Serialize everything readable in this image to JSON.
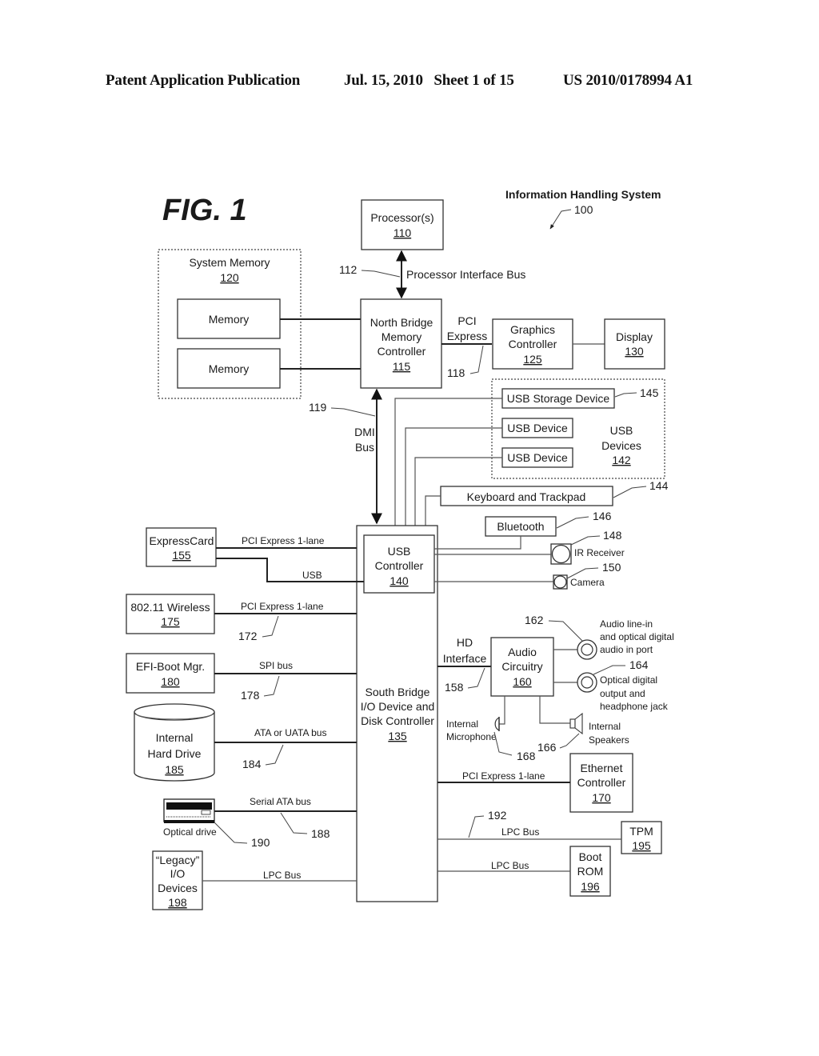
{
  "header": {
    "left": "Patent Application Publication",
    "date_sheet": "Jul. 15, 2010   Sheet 1 of 15",
    "pub_no": "US 2010/0178994 A1"
  },
  "figure": {
    "label": "FIG. 1",
    "system_title": "Information Handling System",
    "system_ref": "100"
  },
  "blocks": {
    "processor": {
      "name": "Processor(s)",
      "ref": "110"
    },
    "system_memory": {
      "name": "System Memory",
      "ref": "120"
    },
    "memory_a": {
      "name": "Memory"
    },
    "memory_b": {
      "name": "Memory"
    },
    "north_bridge": {
      "line1": "North Bridge",
      "line2": "Memory",
      "line3": "Controller",
      "ref": "115"
    },
    "graphics": {
      "line1": "Graphics",
      "line2": "Controller",
      "ref": "125"
    },
    "display": {
      "name": "Display",
      "ref": "130"
    },
    "usb_storage": {
      "name": "USB Storage Device",
      "ref": "145"
    },
    "usb_device_1": {
      "name": "USB Device"
    },
    "usb_device_2": {
      "name": "USB Device"
    },
    "usb_devices_group": {
      "line1": "USB",
      "line2": "Devices",
      "ref": "142"
    },
    "keyboard": {
      "name": "Keyboard and Trackpad",
      "ref": "144"
    },
    "bluetooth": {
      "name": "Bluetooth",
      "ref": "146"
    },
    "ir_receiver": {
      "name": "IR Receiver",
      "ref": "148"
    },
    "camera": {
      "name": "Camera",
      "ref": "150"
    },
    "usb_controller": {
      "line1": "USB",
      "line2": "Controller",
      "ref": "140"
    },
    "expresscard": {
      "name": "ExpressCard",
      "ref": "155"
    },
    "wireless": {
      "name": "802.11 Wireless",
      "ref": "175"
    },
    "efi": {
      "name": "EFI-Boot Mgr.",
      "ref": "180"
    },
    "hard_drive": {
      "line1": "Internal",
      "line2": "Hard Drive",
      "ref": "185"
    },
    "optical": {
      "name": "Optical drive",
      "ref": "190"
    },
    "legacy": {
      "line1": "“Legacy”",
      "line2": "I/O",
      "line3": "Devices",
      "ref": "198"
    },
    "south_bridge": {
      "line1": "South Bridge",
      "line2": "I/O Device and",
      "line3": "Disk Controller",
      "ref": "135"
    },
    "audio": {
      "line1": "Audio",
      "line2": "Circuitry",
      "ref": "160"
    },
    "audio_in": {
      "line1": "Audio line-in",
      "line2": "and optical digital",
      "line3": "audio in port",
      "ref": "162"
    },
    "audio_out": {
      "line1": "Optical digital",
      "line2": "output and",
      "line3": "headphone jack",
      "ref": "164"
    },
    "speakers": {
      "line1": "Internal",
      "line2": "Speakers",
      "ref": "166"
    },
    "microphone": {
      "line1": "Internal",
      "line2": "Microphone",
      "ref": "168"
    },
    "ethernet": {
      "line1": "Ethernet",
      "line2": "Controller",
      "ref": "170"
    },
    "tpm": {
      "name": "TPM",
      "ref": "195"
    },
    "boot_rom": {
      "line1": "Boot",
      "line2": "ROM",
      "ref": "196"
    }
  },
  "buses": {
    "processor_bus": {
      "name": "Processor Interface Bus",
      "ref": "112"
    },
    "pci_express": {
      "line1": "PCI",
      "line2": "Express",
      "ref": "118"
    },
    "dmi": {
      "line1": "DMI",
      "line2": "Bus",
      "ref": "119"
    },
    "expresscard_pcie": {
      "name": "PCI Express 1-lane"
    },
    "expresscard_usb": {
      "name": "USB"
    },
    "wireless_pcie": {
      "name": "PCI Express 1-lane",
      "ref": "172"
    },
    "spi": {
      "name": "SPI bus",
      "ref": "178"
    },
    "ata": {
      "name": "ATA or UATA bus",
      "ref": "184"
    },
    "sata": {
      "name": "Serial ATA bus",
      "ref": "188"
    },
    "legacy_lpc": {
      "name": "LPC Bus"
    },
    "hd_interface": {
      "line1": "HD",
      "line2": "Interface",
      "ref": "158"
    },
    "ethernet_pcie": {
      "name": "PCI Express 1-lane"
    },
    "tpm_lpc": {
      "name": "LPC Bus",
      "ref": "192"
    },
    "bootrom_lpc": {
      "name": "LPC Bus"
    }
  }
}
